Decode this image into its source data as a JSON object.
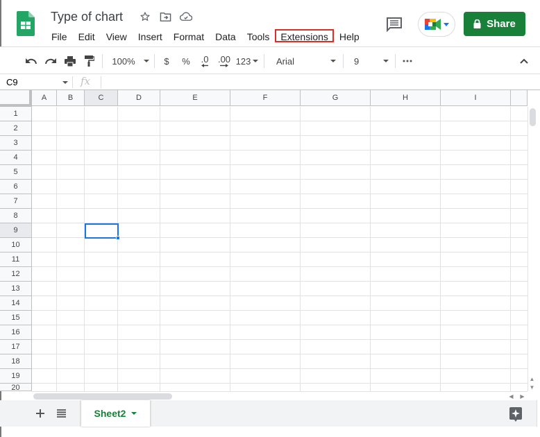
{
  "app": {
    "title": "Type of chart",
    "name": "Google Sheets"
  },
  "header": {
    "icons": [
      "star-icon",
      "move-folder-icon",
      "cloud-saved-icon"
    ],
    "menus": [
      {
        "label": "File"
      },
      {
        "label": "Edit"
      },
      {
        "label": "View"
      },
      {
        "label": "Insert"
      },
      {
        "label": "Format"
      },
      {
        "label": "Data"
      },
      {
        "label": "Tools"
      },
      {
        "label": "Extensions",
        "highlighted": true
      },
      {
        "label": "Help"
      }
    ],
    "share_label": "Share",
    "colors": {
      "share": "#188038",
      "highlight": "#d93025"
    }
  },
  "toolbar": {
    "zoom": "100%",
    "currency": "$",
    "percent": "%",
    "decrease_decimal": ".0",
    "increase_decimal": ".00",
    "more_formats": "123",
    "font": "Arial",
    "font_size": "9"
  },
  "formula_bar": {
    "name_box": "C9",
    "fx": "fx",
    "value": ""
  },
  "grid": {
    "columns": [
      "A",
      "B",
      "C",
      "D",
      "E",
      "F",
      "G",
      "H",
      "I"
    ],
    "rows": [
      "1",
      "2",
      "3",
      "4",
      "5",
      "6",
      "7",
      "8",
      "9",
      "10",
      "11",
      "12",
      "13",
      "14",
      "15",
      "16",
      "17",
      "18",
      "19",
      "20"
    ],
    "selected_cell": "C9",
    "selected_column": "C",
    "selected_row": "9",
    "accent": "#1a73e8"
  },
  "sheets": {
    "tabs": [
      {
        "label": "Sheet2",
        "active": true
      }
    ]
  }
}
